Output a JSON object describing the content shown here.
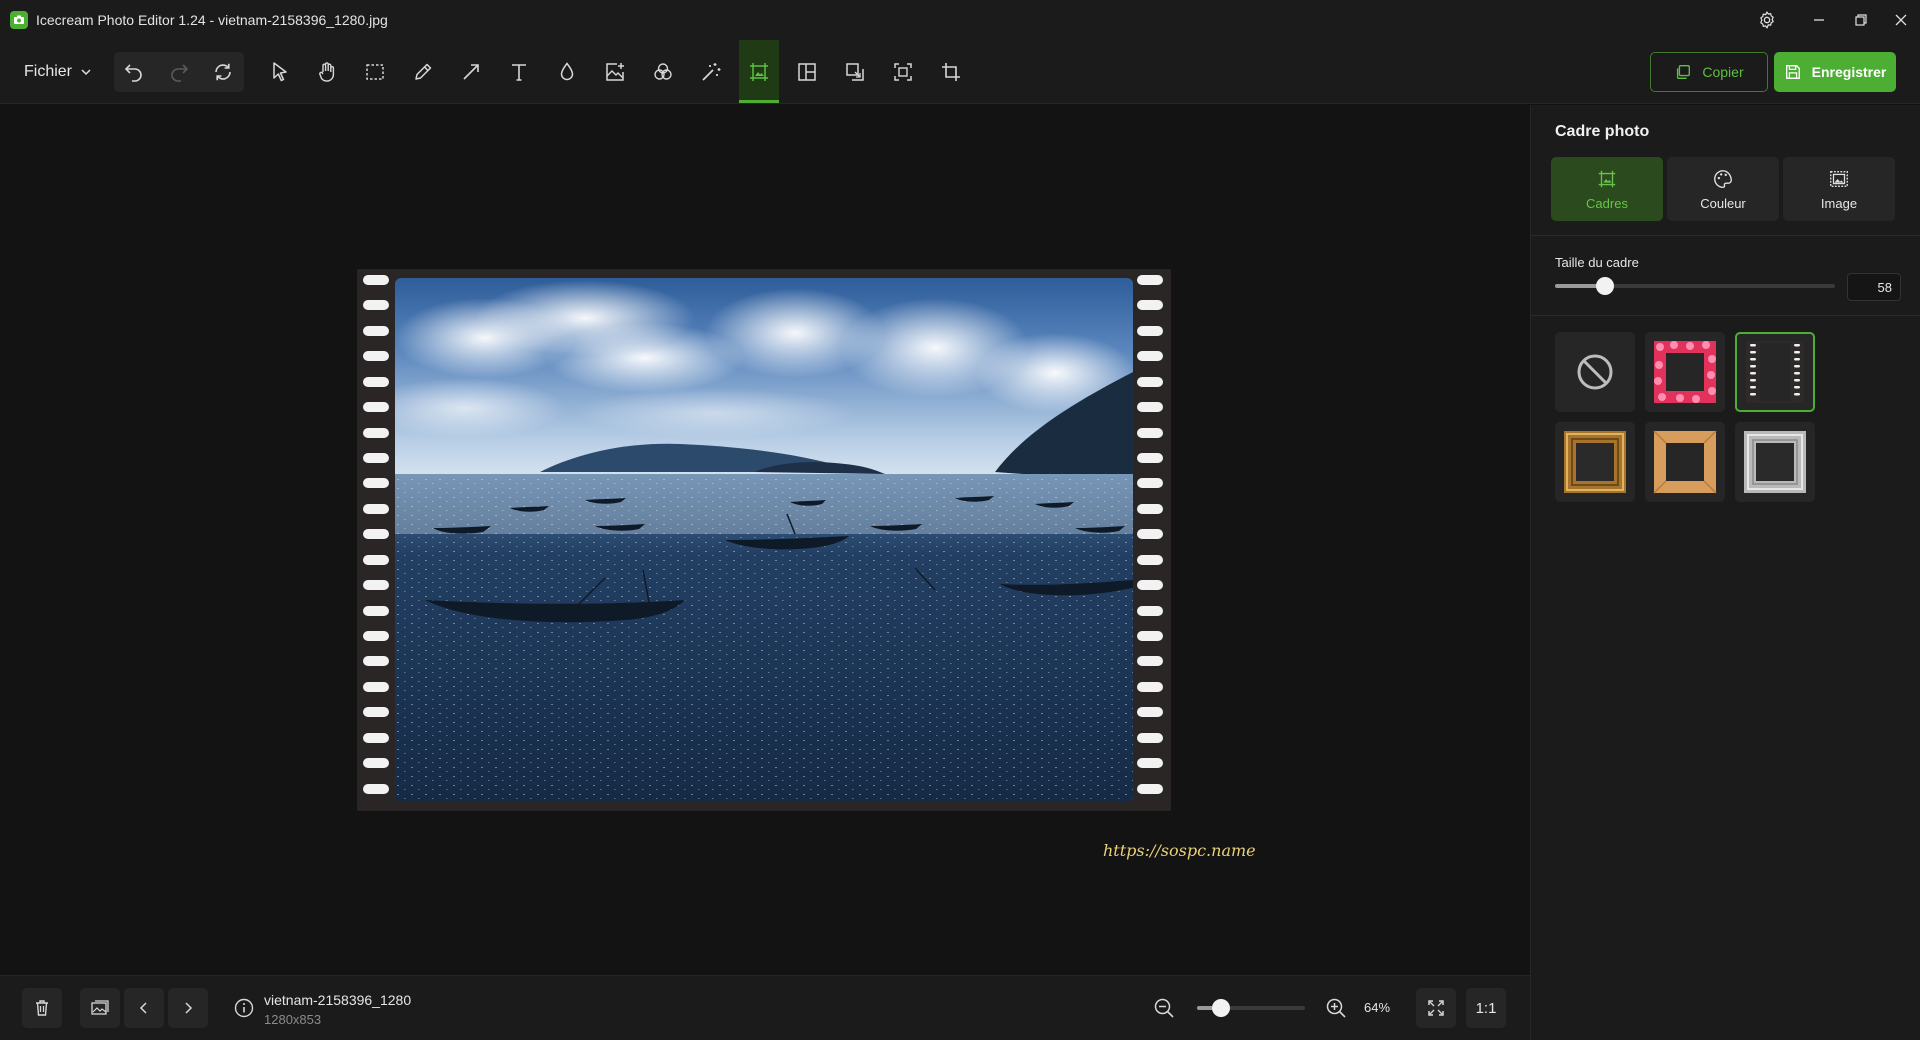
{
  "window": {
    "title": "Icecream Photo Editor 1.24 - vietnam-2158396_1280.jpg"
  },
  "toolbar": {
    "file_menu": "Fichier",
    "tools": [
      "select-tool",
      "hand-tool",
      "marquee-tool",
      "brush-tool",
      "arrow-tool",
      "text-tool",
      "blur-tool",
      "add-image-tool",
      "filters-tool",
      "magic-wand-tool",
      "frame-tool",
      "collage-tool",
      "resize-tool",
      "transform-tool",
      "crop-tool"
    ],
    "active_tool": "frame-tool",
    "copy_label": "Copier",
    "save_label": "Enregistrer"
  },
  "canvas": {
    "watermark": "https://sospc.name"
  },
  "panel": {
    "title": "Cadre photo",
    "tabs": [
      {
        "label": "Cadres",
        "icon": "frame-icon",
        "active": true
      },
      {
        "label": "Couleur",
        "icon": "palette-icon",
        "active": false
      },
      {
        "label": "Image",
        "icon": "image-icon",
        "active": false
      }
    ],
    "frame_size_label": "Taille du cadre",
    "frame_size_value": "58",
    "frame_size_fraction": 0.18,
    "frames": [
      {
        "name": "none",
        "icon": "no-frame-icon"
      },
      {
        "name": "flowers",
        "icon": "flower-frame-icon"
      },
      {
        "name": "film",
        "icon": "film-frame-icon",
        "selected": true
      },
      {
        "name": "gold",
        "icon": "gold-frame-icon"
      },
      {
        "name": "wood",
        "icon": "wood-frame-icon"
      },
      {
        "name": "silver",
        "icon": "silver-frame-icon"
      }
    ]
  },
  "bottom": {
    "file_name": "vietnam-2158396_1280",
    "file_dims": "1280x853",
    "zoom_label": "64%",
    "zoom_fraction": 0.22,
    "ratio_label": "1:1"
  },
  "colors": {
    "accent": "#4cae33",
    "background": "#121212",
    "panel": "#1b1b1b",
    "watermark": "#e9d27a"
  }
}
